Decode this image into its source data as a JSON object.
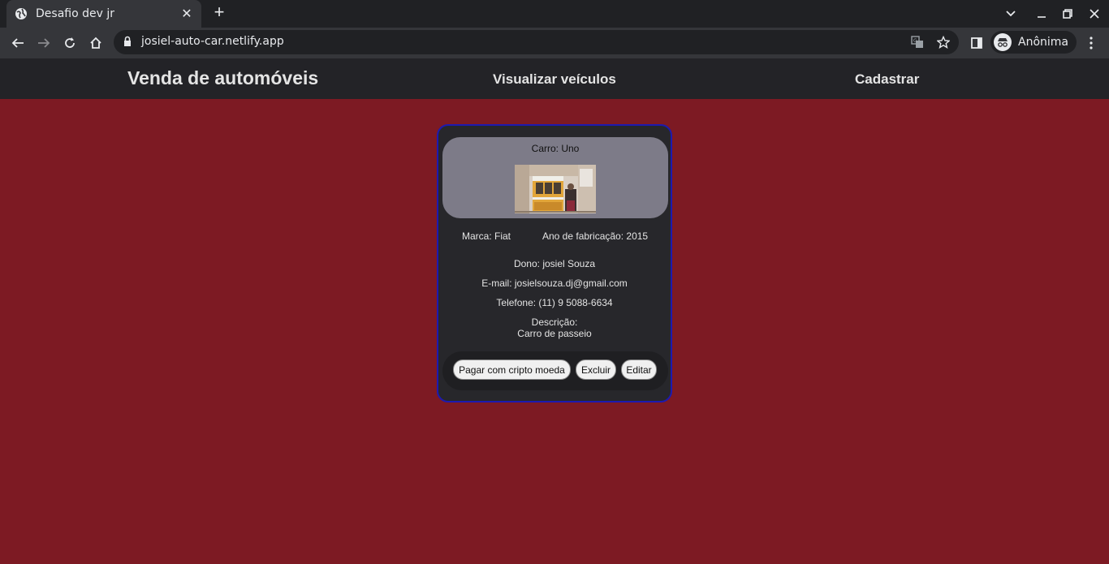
{
  "browser": {
    "tab_title": "Desafio dev jr",
    "url": "josiel-auto-car.netlify.app",
    "profile_label": "Anônima"
  },
  "site": {
    "brand": "Venda de automóveis",
    "nav": {
      "view": "Visualizar veículos",
      "register": "Cadastrar"
    }
  },
  "card": {
    "car": "Carro: Uno",
    "brand": "Marca: Fiat",
    "year": "Ano de fabricação: 2015",
    "owner": "Dono: josiel Souza",
    "email": "E-mail: josielsouza.dj@gmail.com",
    "phone": "Telefone: (11) 9 5088-6634",
    "description_label": "Descrição:",
    "description": "Carro de passeio",
    "buttons": {
      "pay": "Pagar com cripto moeda",
      "delete": "Excluir",
      "edit": "Editar"
    }
  },
  "colors": {
    "page_bg": "#7d1a23",
    "header_bg": "#232327",
    "card_bg": "#27272b",
    "card_border": "#1d1ab0"
  },
  "icons": {
    "favicon": "globe-icon",
    "new_tab": "plus-icon",
    "back": "arrow-left-icon",
    "forward": "arrow-right-icon",
    "reload": "reload-icon",
    "home": "home-icon",
    "lock": "lock-icon",
    "translate": "translate-icon",
    "bookmark": "star-icon",
    "side_panel": "side-panel-icon",
    "incognito": "incognito-icon",
    "menu": "kebab-menu-icon"
  }
}
